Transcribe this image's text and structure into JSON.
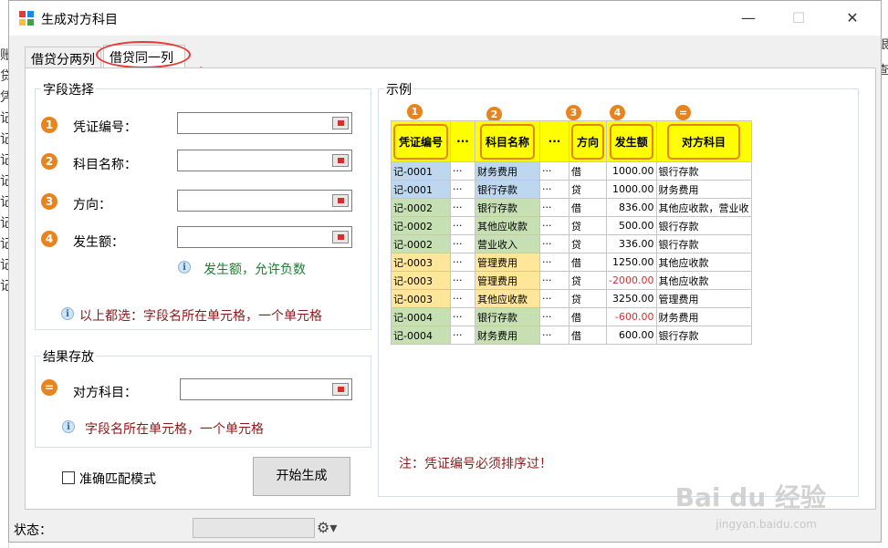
{
  "window": {
    "title": "生成对方科目",
    "minimize": "—",
    "maximize": "☐",
    "close": "✕"
  },
  "background": {
    "left_chars": [
      "账",
      "贷",
      "凭",
      "记",
      "记",
      "记",
      "记",
      "记",
      "记",
      "记",
      "记",
      "记"
    ],
    "right_chars": [
      "银",
      "查"
    ]
  },
  "tabs": [
    {
      "label": "借贷分两列",
      "active": false
    },
    {
      "label": "借贷同一列",
      "active": true
    }
  ],
  "field_group": {
    "title": "字段选择",
    "fields": [
      {
        "index": "1",
        "label": "凭证编号：",
        "value": ""
      },
      {
        "index": "2",
        "label": "科目名称：",
        "value": ""
      },
      {
        "index": "3",
        "label": "方向：",
        "value": ""
      },
      {
        "index": "4",
        "label": "发生额：",
        "value": ""
      }
    ],
    "amount_note": "发生额，允许负数",
    "all_note": "以上都选：字段名所在单元格，一个单元格"
  },
  "result_group": {
    "title": "结果存放",
    "index": "=",
    "label": "对方科目：",
    "value": "",
    "note": "字段名所在单元格，一个单元格"
  },
  "exact_match": {
    "label": "准确匹配模式",
    "checked": false
  },
  "start_button": "开始生成",
  "example": {
    "title": "示例",
    "badges": [
      "1",
      "2",
      "3",
      "4",
      "="
    ],
    "headers": [
      "凭证编号",
      "···",
      "科目名称",
      "···",
      "方向",
      "发生额",
      "对方科目"
    ],
    "rows": [
      {
        "no": "记-0001",
        "d1": "···",
        "subject": "财务费用",
        "d2": "···",
        "dir": "借",
        "amount": "1000.00",
        "neg": false,
        "other": "银行存款",
        "color": "blue"
      },
      {
        "no": "记-0001",
        "d1": "···",
        "subject": "银行存款",
        "d2": "···",
        "dir": "贷",
        "amount": "1000.00",
        "neg": false,
        "other": "财务费用",
        "color": "blue"
      },
      {
        "no": "记-0002",
        "d1": "···",
        "subject": "银行存款",
        "d2": "···",
        "dir": "借",
        "amount": "836.00",
        "neg": false,
        "other": "其他应收款，营业收",
        "color": "green"
      },
      {
        "no": "记-0002",
        "d1": "···",
        "subject": "其他应收款",
        "d2": "···",
        "dir": "贷",
        "amount": "500.00",
        "neg": false,
        "other": "银行存款",
        "color": "green"
      },
      {
        "no": "记-0002",
        "d1": "···",
        "subject": "营业收入",
        "d2": "···",
        "dir": "贷",
        "amount": "336.00",
        "neg": false,
        "other": "银行存款",
        "color": "green"
      },
      {
        "no": "记-0003",
        "d1": "···",
        "subject": "管理费用",
        "d2": "···",
        "dir": "借",
        "amount": "1250.00",
        "neg": false,
        "other": "其他应收款",
        "color": "orange"
      },
      {
        "no": "记-0003",
        "d1": "···",
        "subject": "管理费用",
        "d2": "···",
        "dir": "贷",
        "amount": "-2000.00",
        "neg": true,
        "other": "其他应收款",
        "color": "orange"
      },
      {
        "no": "记-0003",
        "d1": "···",
        "subject": "其他应收款",
        "d2": "···",
        "dir": "贷",
        "amount": "3250.00",
        "neg": false,
        "other": "管理费用",
        "color": "orange"
      },
      {
        "no": "记-0004",
        "d1": "···",
        "subject": "银行存款",
        "d2": "···",
        "dir": "借",
        "amount": "-600.00",
        "neg": true,
        "other": "财务费用",
        "color": "green"
      },
      {
        "no": "记-0004",
        "d1": "···",
        "subject": "财务费用",
        "d2": "···",
        "dir": "借",
        "amount": "600.00",
        "neg": false,
        "other": "银行存款",
        "color": "green"
      }
    ],
    "note": "注：凭证编号必须排序过！"
  },
  "status": {
    "label": "状态：",
    "progress": 0
  },
  "watermark": {
    "main": "Bai du 经验",
    "sub": "jingyan.baidu.com"
  },
  "colors": {
    "accent_orange": "#e7841f",
    "header_yellow": "#ffff00",
    "highlight_red": "#e53935",
    "note_red": "#8b1a1a",
    "note_green": "#1e7e34"
  }
}
